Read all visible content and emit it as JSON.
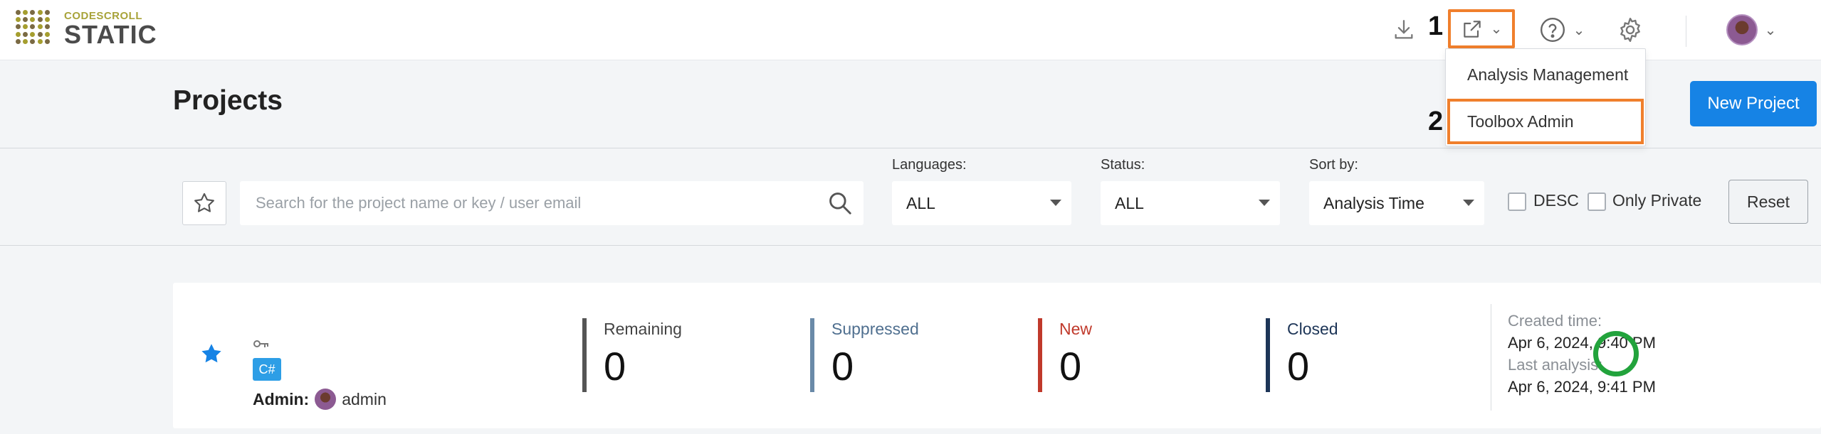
{
  "app": {
    "logo_top": "CODESCROLL",
    "logo_bottom": "STATIC"
  },
  "header": {
    "annotations": {
      "step1": "1",
      "step2": "2"
    },
    "icons": [
      "download-icon",
      "external-link-icon",
      "help-icon",
      "gear-icon",
      "user-avatar"
    ]
  },
  "menu": {
    "items": [
      {
        "label": "Analysis Management"
      },
      {
        "label": "Toolbox Admin"
      }
    ]
  },
  "page": {
    "title": "Projects",
    "new_project_label": "New Project"
  },
  "filters": {
    "search_placeholder": "Search for the project name or key / user email",
    "search_value": "",
    "languages": {
      "label": "Languages:",
      "value": "ALL"
    },
    "status": {
      "label": "Status:",
      "value": "ALL"
    },
    "sort": {
      "label": "Sort by:",
      "value": "Analysis Time"
    },
    "desc_label": "DESC",
    "desc_checked": false,
    "private_label": "Only Private",
    "private_checked": false,
    "reset_label": "Reset"
  },
  "project": {
    "favorite": true,
    "language": "C#",
    "admin_label": "Admin:",
    "admin_name": "admin",
    "stats": [
      {
        "label": "Remaining",
        "value": "0",
        "color": "#555555"
      },
      {
        "label": "Suppressed",
        "value": "0",
        "color": "#6a8aa8"
      },
      {
        "label": "New",
        "value": "0",
        "color": "#c0392b"
      },
      {
        "label": "Closed",
        "value": "0",
        "color": "#1d3557"
      }
    ],
    "created_label": "Created time:",
    "created_value": "Apr 6, 2024, 9:40 PM",
    "last_label": "Last analysis:",
    "last_value": "Apr 6, 2024, 9:41 PM",
    "status_color": "#22a33c"
  },
  "colors": {
    "accent": "#1683e5",
    "highlight": "#f07f2c"
  }
}
